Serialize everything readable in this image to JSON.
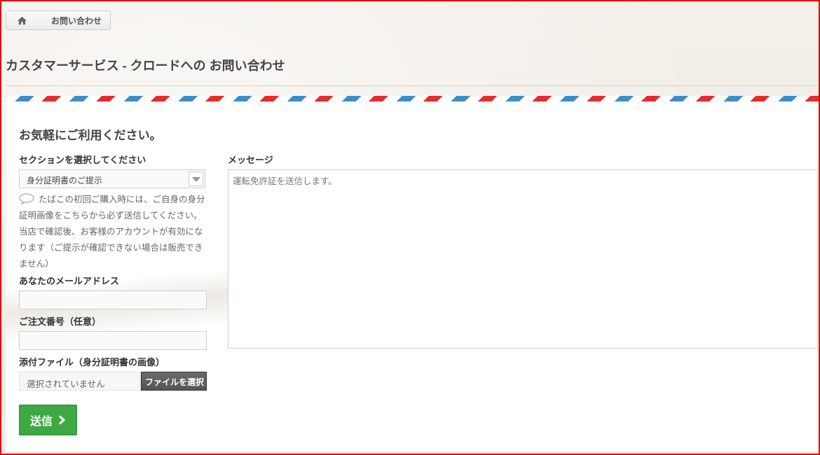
{
  "breadcrumb": {
    "home_icon": "home-icon",
    "current": "お問い合わせ"
  },
  "page_title": "カスタマーサービス - クロードへの お問い合わせ",
  "form": {
    "heading": "お気軽にご利用ください。",
    "section_label": "セクションを選択してください",
    "section_value": "身分証明書のご提示",
    "help_text": "たばこの初回ご購入時には、ご自身の身分証明画像をこちらから必ず送信してください。当店で確認後、お客様のアカウントが有効になります（ご提示が確認できない場合は販売できません）",
    "email_label": "あなたのメールアドレス",
    "email_value": "",
    "order_label": "ご注文番号（任意）",
    "order_value": "",
    "file_label": "添付ファイル（身分証明書の画像）",
    "file_status": "選択されていません",
    "file_button": "ファイルを選択",
    "submit_label": "送信",
    "message_label": "メッセージ",
    "message_value": "運転免許証を送信します。"
  },
  "colors": {
    "frame": "#e60000",
    "airmail_red": "#e52b2b",
    "airmail_blue": "#3b8ec6",
    "submit": "#3ea844"
  }
}
